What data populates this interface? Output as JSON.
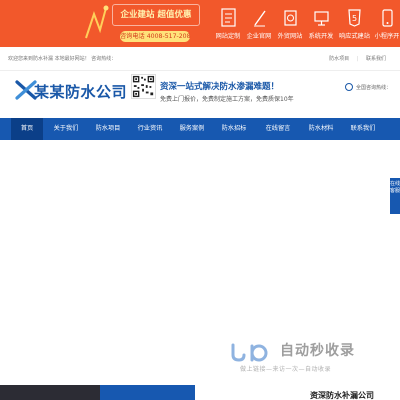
{
  "promo": {
    "headline": "企业建站 超值优惠",
    "phone": "咨询电话 4008-517-208",
    "features": [
      {
        "label": "网站定制",
        "icon": "document-icon"
      },
      {
        "label": "企业官网",
        "icon": "pen-icon"
      },
      {
        "label": "外贸网站",
        "icon": "globe-icon"
      },
      {
        "label": "系统开发",
        "icon": "monitor-icon"
      },
      {
        "label": "响应式建站",
        "icon": "html5-icon"
      },
      {
        "label": "小程序开",
        "icon": "phone-icon"
      }
    ],
    "colors": {
      "background": "#f2582b",
      "accent": "#ffe27a"
    }
  },
  "topbar": {
    "welcome": "欢迎您来到防水补漏 本地最好网站！ 咨询热线：",
    "links": [
      "防水项目",
      "联系我们"
    ]
  },
  "header": {
    "logo_text": "某某防水公司",
    "slogan_main": "资深一站式解决防水渗漏难题！",
    "slogan_sub": "免费上门报价，免费制定施工方案，免费质保10年",
    "hotline_label": "全国咨询热线："
  },
  "nav": {
    "items": [
      "首页",
      "关于我们",
      "防水项目",
      "行业资讯",
      "服务案例",
      "防水招标",
      "在线留言",
      "防水材料",
      "联系我们"
    ],
    "active_index": 0,
    "colors": {
      "background": "#1758b0",
      "active": "#0b3f88"
    }
  },
  "side_tab": {
    "label": "在线客服"
  },
  "watermark": {
    "title": "自动秒收录",
    "subtitle": "做上链接—来访一次—自动收录"
  },
  "bottom": {
    "title": "资深防水补漏公司"
  }
}
